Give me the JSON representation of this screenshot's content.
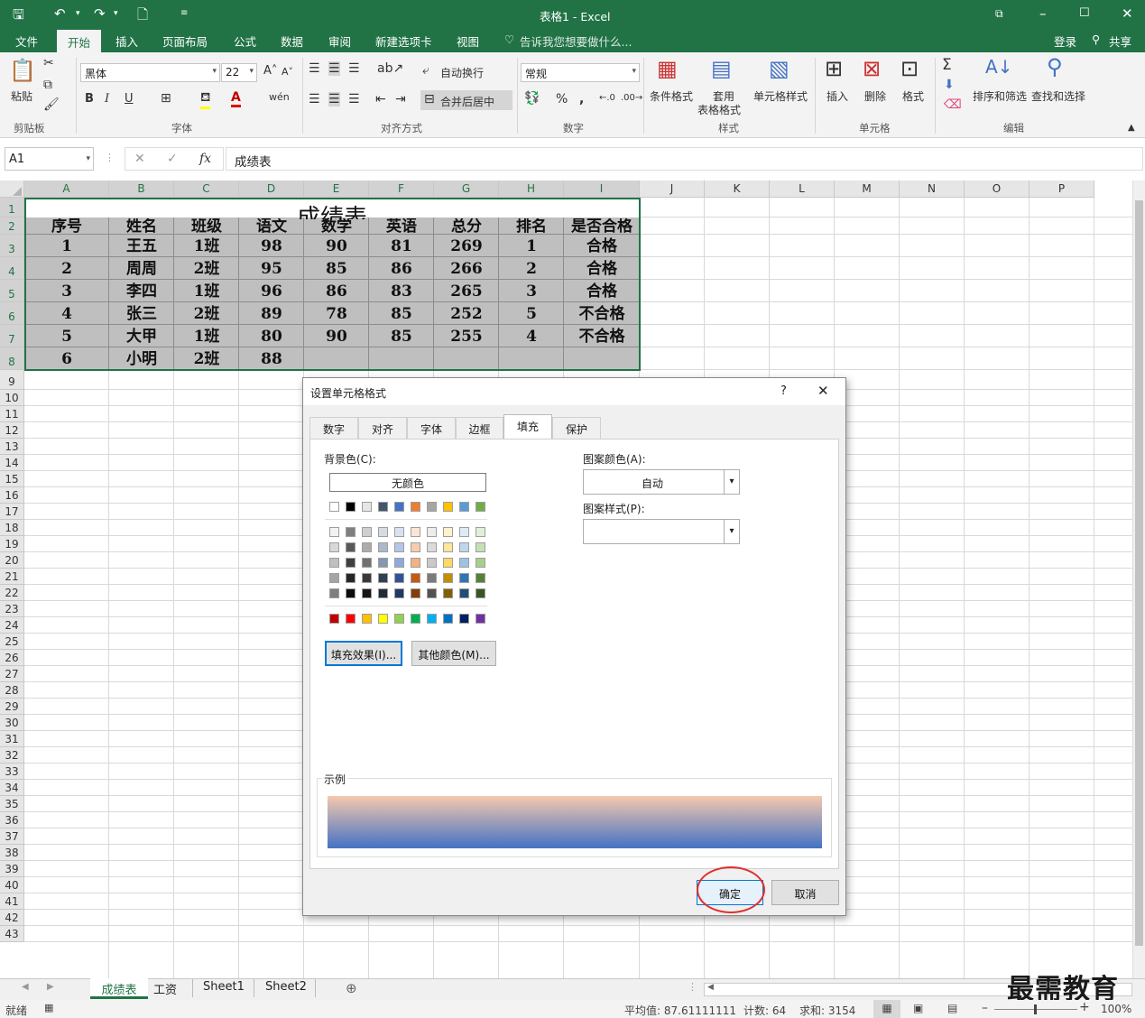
{
  "window": {
    "title": "表格1 - Excel"
  },
  "ribbon_tabs": [
    "文件",
    "开始",
    "插入",
    "页面布局",
    "公式",
    "数据",
    "审阅",
    "新建选项卡",
    "视图"
  ],
  "tell_me": "告诉我您想要做什么...",
  "account": {
    "signin": "登录",
    "share": "共享"
  },
  "ribbon": {
    "clipboard": {
      "paste": "粘贴",
      "label": "剪贴板"
    },
    "font": {
      "name": "黑体",
      "size": "22",
      "label": "字体",
      "bold": "B",
      "italic": "I",
      "underline": "U"
    },
    "alignment": {
      "wrap": "自动换行",
      "merge": "合并后居中",
      "label": "对齐方式"
    },
    "number": {
      "format": "常规",
      "label": "数字",
      "percent": "%",
      "comma": ","
    },
    "styles": {
      "conditional": "条件格式",
      "table_format_1": "套用",
      "table_format_2": "表格格式",
      "cell_styles": "单元格样式",
      "label": "样式"
    },
    "cells": {
      "insert": "插入",
      "delete": "删除",
      "format": "格式",
      "label": "单元格"
    },
    "editing": {
      "sort_filter": "排序和筛选",
      "find_select": "查找和选择",
      "label": "编辑",
      "sigma": "Σ"
    }
  },
  "formula_bar": {
    "name_box": "A1",
    "fx": "fx",
    "content": "成绩表"
  },
  "columns": [
    "A",
    "B",
    "C",
    "D",
    "E",
    "F",
    "G",
    "H",
    "I",
    "J",
    "K",
    "L",
    "M",
    "N",
    "O",
    "P"
  ],
  "rows": [
    "1",
    "2",
    "3",
    "4",
    "5",
    "6",
    "7",
    "8",
    "9",
    "10",
    "11",
    "12",
    "13",
    "14",
    "15",
    "16",
    "17",
    "18",
    "19",
    "20",
    "21",
    "22",
    "23",
    "24",
    "25",
    "26",
    "27",
    "28",
    "29",
    "30",
    "31",
    "32",
    "33",
    "34",
    "35",
    "36",
    "37",
    "38",
    "39",
    "40",
    "41",
    "42",
    "43"
  ],
  "sheet": {
    "title": "成绩表",
    "headers": [
      "序号",
      "姓名",
      "班级",
      "语文",
      "数学",
      "英语",
      "总分",
      "排名",
      "是否合格"
    ],
    "data": [
      [
        "1",
        "王五",
        "1班",
        "98",
        "90",
        "81",
        "269",
        "1",
        "合格"
      ],
      [
        "2",
        "周周",
        "2班",
        "95",
        "85",
        "86",
        "266",
        "2",
        "合格"
      ],
      [
        "3",
        "李四",
        "1班",
        "96",
        "86",
        "83",
        "265",
        "3",
        "合格"
      ],
      [
        "4",
        "张三",
        "2班",
        "89",
        "78",
        "85",
        "252",
        "5",
        "不合格"
      ],
      [
        "5",
        "大甲",
        "1班",
        "80",
        "90",
        "85",
        "255",
        "4",
        "不合格"
      ],
      [
        "6",
        "小明",
        "2班",
        "88",
        "",
        "",
        "",
        "",
        ""
      ]
    ]
  },
  "dialog": {
    "title": "设置单元格格式",
    "help": "?",
    "tabs": [
      "数字",
      "对齐",
      "字体",
      "边框",
      "填充",
      "保护"
    ],
    "active_tab": "填充",
    "bg_color_label": "背景色(C):",
    "no_color": "无颜色",
    "pattern_color_label": "图案颜色(A):",
    "pattern_color_value": "自动",
    "pattern_style_label": "图案样式(P):",
    "fill_effects": "填充效果(I)...",
    "more_colors": "其他颜色(M)...",
    "sample_label": "示例",
    "ok": "确定",
    "cancel": "取消",
    "gradient": {
      "top": "#f5c9ad",
      "bottom": "#4472c4"
    },
    "theme_top": [
      "#ffffff",
      "#000000",
      "#e7e6e6",
      "#44546a",
      "#4472c4",
      "#ed7d31",
      "#a5a5a5",
      "#ffc000",
      "#5b9bd5",
      "#70ad47"
    ],
    "theme_shades": [
      [
        "#f2f2f2",
        "#7f7f7f",
        "#d0cece",
        "#d6dce4",
        "#d9e2f3",
        "#fbe5d5",
        "#ededed",
        "#fff2cc",
        "#deebf6",
        "#e2efd9"
      ],
      [
        "#d8d8d8",
        "#595959",
        "#aeabab",
        "#adb9ca",
        "#b4c6e7",
        "#f7cbac",
        "#dbdbdb",
        "#fee599",
        "#bdd7ee",
        "#c5e0b3"
      ],
      [
        "#bfbfbf",
        "#3f3f3f",
        "#757070",
        "#8496b0",
        "#8eaadb",
        "#f4b183",
        "#c9c9c9",
        "#ffd965",
        "#9cc3e5",
        "#a8d08d"
      ],
      [
        "#a5a5a5",
        "#262626",
        "#3a3838",
        "#323f4f",
        "#2f5496",
        "#c55a11",
        "#7b7b7b",
        "#bf9000",
        "#2e75b5",
        "#538135"
      ],
      [
        "#7f7f7f",
        "#0c0c0c",
        "#171616",
        "#222a35",
        "#1f3864",
        "#843c0b",
        "#525252",
        "#7f6000",
        "#1e4e79",
        "#375623"
      ]
    ],
    "standard": [
      "#c00000",
      "#ff0000",
      "#ffc000",
      "#ffff00",
      "#92d050",
      "#00b050",
      "#00b0f0",
      "#0070c0",
      "#002060",
      "#7030a0"
    ]
  },
  "sheet_tabs": [
    "成绩表",
    "工资",
    "Sheet1",
    "Sheet2"
  ],
  "status": {
    "ready": "就绪",
    "average": "平均值: 87.61111111",
    "count": "计数: 64",
    "sum": "求和: 3154",
    "zoom": "100%"
  },
  "watermark": "最需教育"
}
